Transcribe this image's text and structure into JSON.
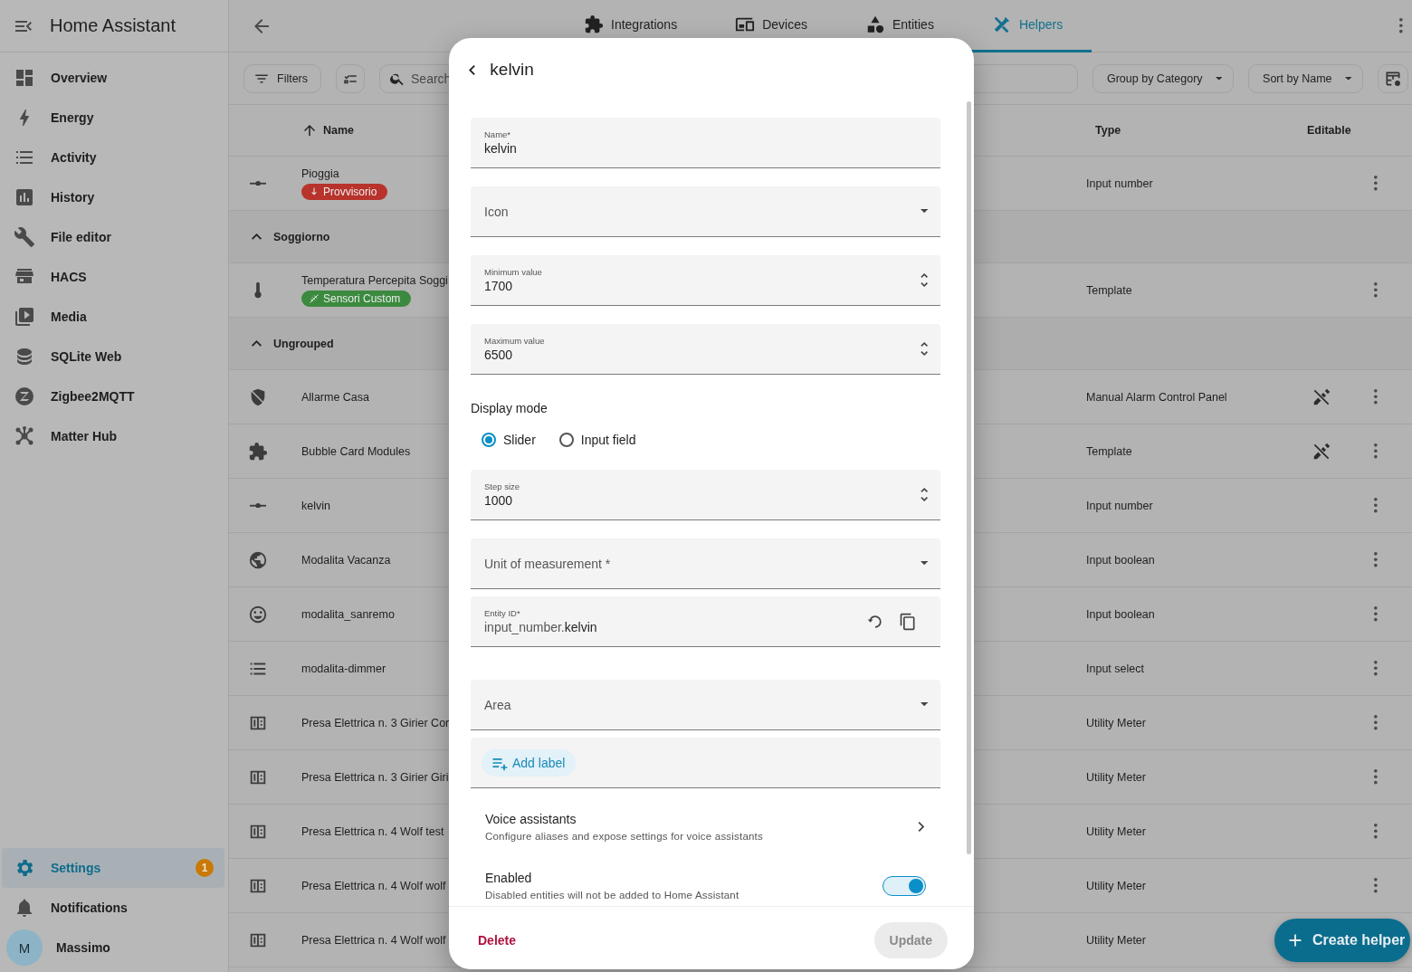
{
  "sidebar": {
    "title": "Home Assistant",
    "items": [
      {
        "label": "Overview",
        "selected": false
      },
      {
        "label": "Energy",
        "selected": false
      },
      {
        "label": "Activity",
        "selected": false
      },
      {
        "label": "History",
        "selected": false
      },
      {
        "label": "File editor",
        "selected": false
      },
      {
        "label": "HACS",
        "selected": false
      },
      {
        "label": "Media",
        "selected": false
      },
      {
        "label": "SQLite Web",
        "selected": false
      },
      {
        "label": "Zigbee2MQTT",
        "selected": false
      },
      {
        "label": "Matter Hub",
        "selected": false
      }
    ],
    "settings": {
      "label": "Settings",
      "badge": "1",
      "selected": true
    },
    "notifications": {
      "label": "Notifications"
    },
    "user": {
      "initial": "M",
      "name": "Massimo"
    }
  },
  "tabs": [
    {
      "label": "Integrations",
      "selected": false
    },
    {
      "label": "Devices",
      "selected": false
    },
    {
      "label": "Entities",
      "selected": false
    },
    {
      "label": "Helpers",
      "selected": true
    }
  ],
  "toolbar": {
    "filters": "Filters",
    "search": {
      "placeholder": "Search"
    },
    "group_by": "Group by Category",
    "sort_by": "Sort by Name"
  },
  "table": {
    "columns": [
      "Name",
      "Type",
      "Editable"
    ],
    "rows": [
      {
        "kind": "item",
        "name": "Pioggia",
        "tag": {
          "text": "Provvisorio",
          "color": "#b8332c"
        },
        "type": "Input number",
        "editable": true
      },
      {
        "kind": "group",
        "name": "Soggiorno",
        "expanded": true
      },
      {
        "kind": "item",
        "name": "Temperatura Percepita Soggi",
        "tag": {
          "text": "Sensori Custom",
          "color": "#3b8a3f"
        },
        "type": "Template",
        "editable": true
      },
      {
        "kind": "group",
        "name": "Ungrouped",
        "expanded": true
      },
      {
        "kind": "item",
        "name": "Allarme Casa",
        "type": "Manual Alarm Control Panel",
        "editable": false
      },
      {
        "kind": "item",
        "name": "Bubble Card Modules",
        "type": "Template",
        "editable": false
      },
      {
        "kind": "item",
        "name": "kelvin",
        "type": "Input number",
        "editable": true
      },
      {
        "kind": "item",
        "name": "Modalita Vacanza",
        "type": "Input boolean",
        "editable": true
      },
      {
        "kind": "item",
        "name": "modalita_sanremo",
        "type": "Input boolean",
        "editable": true
      },
      {
        "kind": "item",
        "name": "modalita-dimmer",
        "type": "Input select",
        "editable": true
      },
      {
        "kind": "item",
        "name": "Presa Elettrica n. 3 Girier Cor",
        "type": "Utility Meter",
        "editable": true
      },
      {
        "kind": "item",
        "name": "Presa Elettrica n. 3 Girier Giri",
        "type": "Utility Meter",
        "editable": true
      },
      {
        "kind": "item",
        "name": "Presa Elettrica n. 4 Wolf test",
        "type": "Utility Meter",
        "editable": true
      },
      {
        "kind": "item",
        "name": "Presa Elettrica n. 4 Wolf wolf",
        "type": "Utility Meter",
        "editable": true
      },
      {
        "kind": "item",
        "name": "Presa Elettrica n. 4 Wolf wolf",
        "type": "Utility Meter",
        "editable": true
      }
    ]
  },
  "fab": {
    "label": "Create helper"
  },
  "dialog": {
    "title": "kelvin",
    "items": [
      {
        "kind": "text",
        "label": "Name*",
        "value": "kelvin"
      },
      {
        "kind": "select",
        "label": "Icon"
      },
      {
        "kind": "number",
        "label": "Minimum value",
        "value": "1700"
      },
      {
        "kind": "number",
        "label": "Maximum value",
        "value": "6500"
      },
      {
        "kind": "radio",
        "label": "Display mode",
        "options": [
          {
            "label": "Slider",
            "selected": true
          },
          {
            "label": "Input field",
            "selected": false
          }
        ]
      },
      {
        "kind": "number",
        "label": "Step size",
        "value": "1000"
      },
      {
        "kind": "select",
        "label": "Unit of measurement *"
      },
      {
        "kind": "entity",
        "label": "Entity ID*",
        "prefix": "input_number.",
        "value": "kelvin"
      },
      {
        "kind": "select",
        "label": "Area"
      },
      {
        "kind": "labels",
        "button": "Add label"
      },
      {
        "kind": "nav",
        "title": "Voice assistants",
        "subtitle": "Configure aliases and expose settings for voice assistants"
      },
      {
        "kind": "toggle",
        "title": "Enabled",
        "subtitle": "Disabled entities will not be added to Home Assistant",
        "on": true
      }
    ],
    "delete": "Delete",
    "update": {
      "label": "Update",
      "disabled": true
    }
  }
}
